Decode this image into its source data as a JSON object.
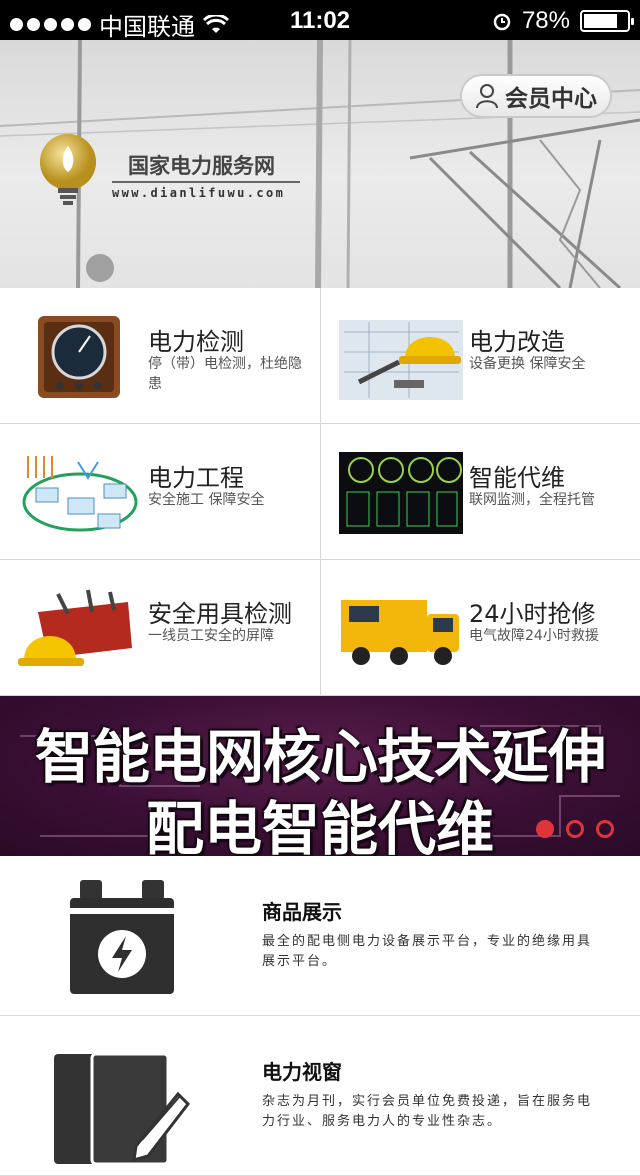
{
  "status_bar": {
    "carrier": "中国联通",
    "time": "11:02",
    "battery": "78%",
    "battery_level": 0.78
  },
  "header": {
    "member_button": "会员中心",
    "site_name": "国家电力服务网",
    "site_url": "www.dianlifuwu.com"
  },
  "services": [
    {
      "title": "电力检测",
      "desc": "停（带）电检测，杜绝隐患",
      "icon": "meter-gauge-icon"
    },
    {
      "title": "电力改造",
      "desc": "设备更换 保障安全",
      "icon": "blueprint-helmet-icon"
    },
    {
      "title": "电力工程",
      "desc": "安全施工  保障安全",
      "icon": "substation-diagram-icon"
    },
    {
      "title": "智能代维",
      "desc": "联网监测，全程托管",
      "icon": "monitor-panel-icon"
    },
    {
      "title": "安全用具检测",
      "desc": "一线员工安全的屏障",
      "icon": "toolbag-helmet-icon"
    },
    {
      "title": "24小时抢修",
      "desc": "电气故障24小时救援",
      "icon": "repair-truck-icon"
    }
  ],
  "promo": {
    "line1": "智能电网核心技术延伸",
    "line2": "配电智能代维",
    "slide_count": 3,
    "active_slide": 1
  },
  "list": [
    {
      "title": "商品展示",
      "desc": "最全的配电侧电力设备展示平台，专业的绝缘用具展示平台。",
      "icon": "battery-bolt-icon"
    },
    {
      "title": "电力视窗",
      "desc": "杂志为月刊，实行会员单位免费投递，旨在服务电力行业、服务电力人的专业性杂志。",
      "icon": "book-pencil-icon"
    }
  ]
}
